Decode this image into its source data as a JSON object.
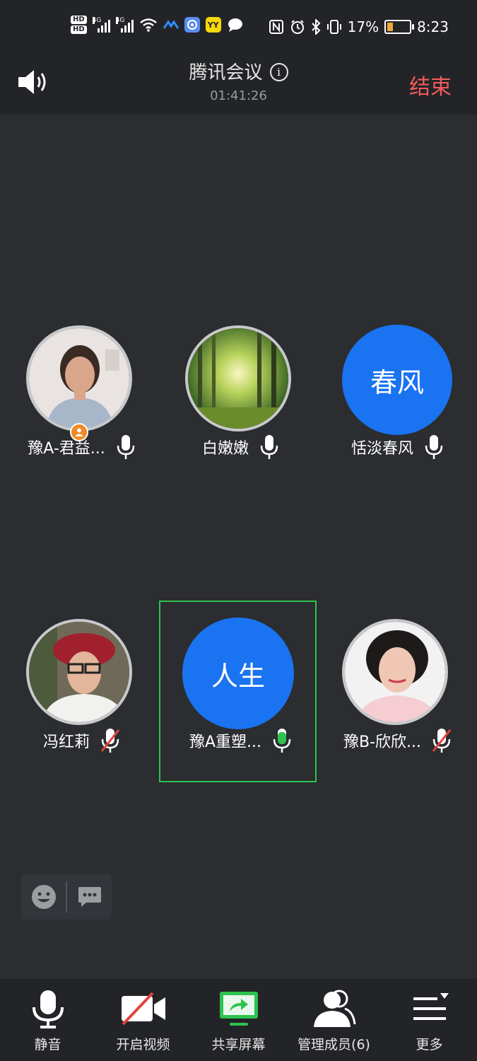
{
  "status_bar": {
    "hd1": "HD",
    "hd2": "HD",
    "net1": "4G",
    "net2": "4G",
    "yy_icon_text": "YY",
    "battery_text": "17%",
    "battery_level": 0.17,
    "time": "8:23",
    "icons": [
      "nfc-icon",
      "alarm-icon",
      "bluetooth-icon",
      "vibrate-icon",
      "wifi-icon",
      "chat-bubble-icon"
    ]
  },
  "header": {
    "title": "腾讯会议",
    "timer": "01:41:26",
    "end_label": "结束",
    "end_color": "#f25c5c"
  },
  "participants": [
    {
      "name": "豫A-君益...",
      "mic": "on",
      "avatar": "photo",
      "host": true
    },
    {
      "name": "白嫩嫩",
      "mic": "on",
      "avatar": "photo"
    },
    {
      "name": "恬淡春风",
      "mic": "on",
      "avatar": "initials",
      "initials": "春风"
    },
    {
      "name": "冯红莉",
      "mic": "muted",
      "avatar": "photo"
    },
    {
      "name": "豫A重塑...",
      "mic": "speaking",
      "avatar": "initials",
      "initials": "人生",
      "active_speaker": true
    },
    {
      "name": "豫B-欣欣...",
      "mic": "muted",
      "avatar": "photo"
    }
  ],
  "toolbar": {
    "mute_label": "静音",
    "video_label": "开启视频",
    "share_label": "共享屏幕",
    "members_label": "管理成员(6)",
    "more_label": "更多"
  },
  "colors": {
    "accent_blue": "#1a73f0",
    "speaking_green": "#2ec24f",
    "muted_red": "#e0443e",
    "host_orange": "#f08a24"
  }
}
